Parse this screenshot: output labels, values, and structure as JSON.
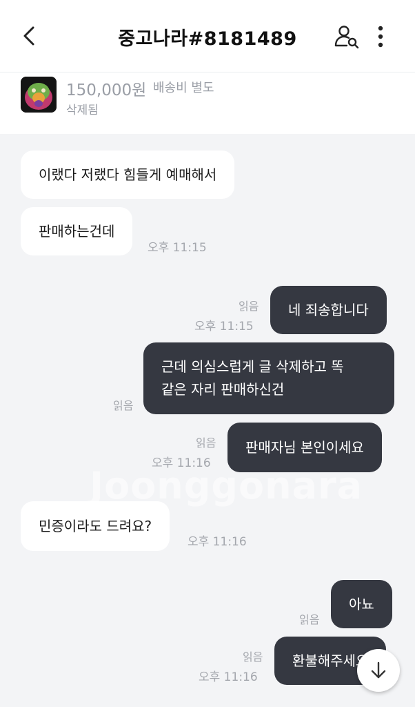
{
  "header": {
    "title": "중고나라#8181489",
    "back_icon": "chevron-left-icon",
    "profile_icon": "user-search-icon",
    "more_icon": "more-vertical-icon"
  },
  "product": {
    "price": "150,000원",
    "shipping": "배송비 별도",
    "status": "삭제됨"
  },
  "watermark": "Joonggonara",
  "messages": {
    "m1": "이랬다 저랬다 힘들게 예매해서",
    "m2": "판매하는건데",
    "m2_time": "오후 11:15",
    "m3": "네 죄송합니다",
    "m3_read": "읽음",
    "m3_time": "오후 11:15",
    "m4_line1": "근데 의심스럽게 글 삭제하고 똑",
    "m4_line2": "같은 자리 판매하신건",
    "m4_read": "읽음",
    "m5": "판매자님 본인이세요",
    "m5_read": "읽음",
    "m5_time": "오후 11:16",
    "m6": "민증이라도 드려요?",
    "m6_time": "오후 11:16",
    "m7": "아뇨",
    "m7_read": "읽음",
    "m8": "환불해주세요",
    "m8_read": "읽음",
    "m8_time": "오후 11:16"
  },
  "scroll_icon": "arrow-down-icon"
}
